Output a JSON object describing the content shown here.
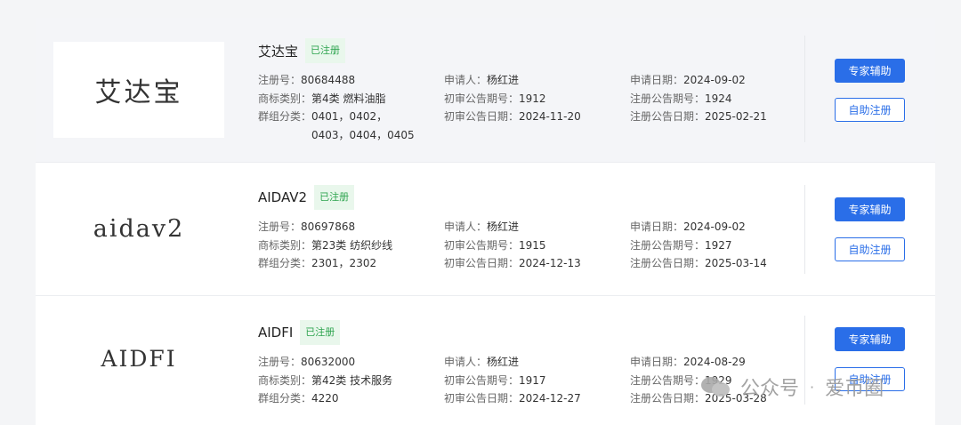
{
  "trademarks": [
    {
      "logo_text": "艾达宝",
      "name": "艾达宝",
      "status": "已注册",
      "reg_no_label": "注册号：",
      "reg_no": "80684488",
      "applicant_label": "申请人：",
      "applicant": "杨红进",
      "apply_date_label": "申请日期：",
      "apply_date": "2024-09-02",
      "class_label": "商标类别：",
      "class": "第4类 燃料油脂",
      "prelim_no_label": "初审公告期号：",
      "prelim_no": "1912",
      "reg_pub_no_label": "注册公告期号：",
      "reg_pub_no": "1924",
      "group_label": "群组分类：",
      "group": "0401，0402，0403，0404，0405",
      "prelim_date_label": "初审公告日期：",
      "prelim_date": "2024-11-20",
      "reg_pub_date_label": "注册公告日期：",
      "reg_pub_date": "2025-02-21",
      "expert_btn": "专家辅助",
      "self_btn": "自助注册"
    },
    {
      "logo_text": "aidav2",
      "name": "AIDAV2",
      "status": "已注册",
      "reg_no_label": "注册号：",
      "reg_no": "80697868",
      "applicant_label": "申请人：",
      "applicant": "杨红进",
      "apply_date_label": "申请日期：",
      "apply_date": "2024-09-02",
      "class_label": "商标类别：",
      "class": "第23类 纺织纱线",
      "prelim_no_label": "初审公告期号：",
      "prelim_no": "1915",
      "reg_pub_no_label": "注册公告期号：",
      "reg_pub_no": "1927",
      "group_label": "群组分类：",
      "group": "2301，2302",
      "prelim_date_label": "初审公告日期：",
      "prelim_date": "2024-12-13",
      "reg_pub_date_label": "注册公告日期：",
      "reg_pub_date": "2025-03-14",
      "expert_btn": "专家辅助",
      "self_btn": "自助注册"
    },
    {
      "logo_text": "AIDFI",
      "name": "AIDFI",
      "status": "已注册",
      "reg_no_label": "注册号：",
      "reg_no": "80632000",
      "applicant_label": "申请人：",
      "applicant": "杨红进",
      "apply_date_label": "申请日期：",
      "apply_date": "2024-08-29",
      "class_label": "商标类别：",
      "class": "第42类 技术服务",
      "prelim_no_label": "初审公告期号：",
      "prelim_no": "1917",
      "reg_pub_no_label": "注册公告期号：",
      "reg_pub_no": "1929",
      "group_label": "群组分类：",
      "group": "4220",
      "prelim_date_label": "初审公告日期：",
      "prelim_date": "2024-12-27",
      "reg_pub_date_label": "注册公告日期：",
      "reg_pub_date": "2025-03-28",
      "expert_btn": "专家辅助",
      "self_btn": "自助注册"
    }
  ],
  "watermark": {
    "icon": "wechat-icon",
    "text": "公众号",
    "separator": "·",
    "account": "爱币圈"
  },
  "colors": {
    "primary": "#2a6ee8",
    "status_green": "#2ea44f",
    "status_bg": "#e9f7ec"
  }
}
